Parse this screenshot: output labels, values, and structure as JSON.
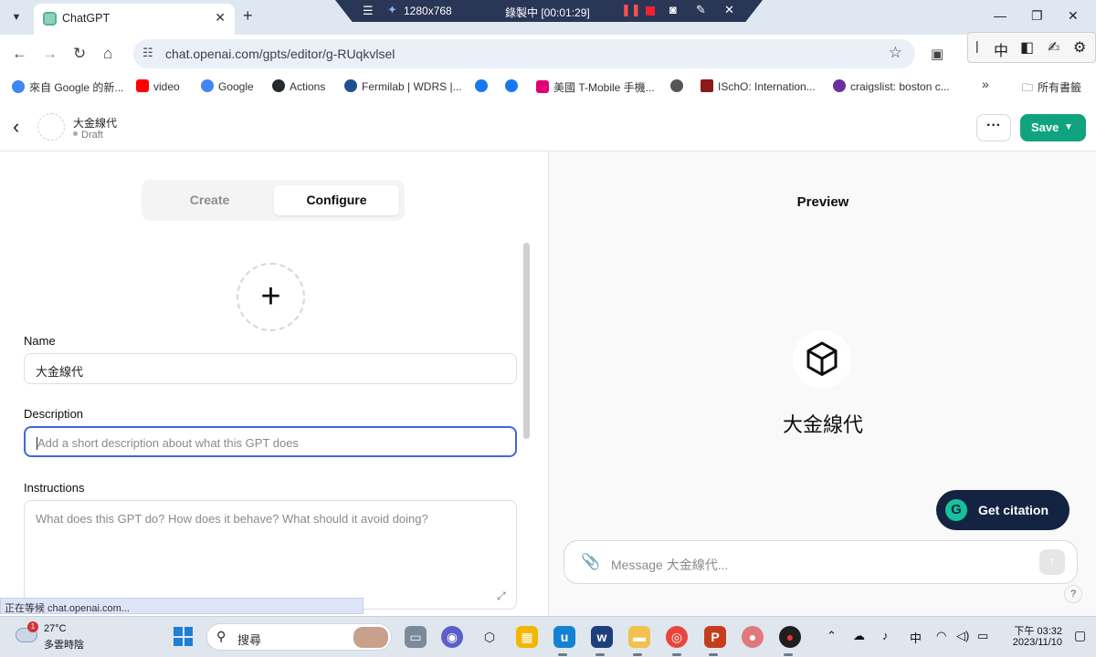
{
  "browser": {
    "tab_title": "ChatGPT",
    "tab_close": "✕",
    "new_tab": "+",
    "url": "chat.openai.com/gpts/editor/g-RUqkvlsel",
    "status_tip": "正在等候 chat.openai.com...",
    "bookmarks": [
      {
        "label": "來自 Google 的新...",
        "icon_color": "#4285f4"
      },
      {
        "label": "video",
        "icon_color": "#ff0000"
      },
      {
        "label": "Google",
        "icon_color": "#4285f4"
      },
      {
        "label": "Actions",
        "icon_color": "#24292f"
      },
      {
        "label": "Fermilab | WDRS |...",
        "icon_color": "#1f4f8f"
      },
      {
        "label": "",
        "icon_color": "#1877f2"
      },
      {
        "label": "",
        "icon_color": "#1877f2"
      },
      {
        "label": "美國 T-Mobile 手機...",
        "icon_color": "#e20074"
      },
      {
        "label": "",
        "icon_color": "#555555"
      },
      {
        "label": "ISchO: Internation...",
        "icon_color": "#8b1a1a"
      },
      {
        "label": "craigslist: boston c...",
        "icon_color": "#6b2fa0"
      }
    ],
    "bookmarks_more": "»",
    "all_bookmarks": "所有書籤"
  },
  "recorder": {
    "resolution": "1280x768",
    "status": "錄製中 [00:01:29]"
  },
  "ime": {
    "mode": "中"
  },
  "header": {
    "gpt_name": "大金線代",
    "status": "Draft",
    "more_label": "···",
    "save_label": "Save"
  },
  "editor": {
    "tabs": [
      "Create",
      "Configure"
    ],
    "active_tab": "Configure",
    "upload_symbol": "+",
    "name_label": "Name",
    "name_value": "大金線代",
    "description_label": "Description",
    "description_placeholder": "Add a short description about what this GPT does",
    "instructions_label": "Instructions",
    "instructions_placeholder": "What does this GPT do? How does it behave? What should it avoid doing?"
  },
  "preview": {
    "title": "Preview",
    "gpt_name": "大金線代",
    "citation_label": "Get citation",
    "message_placeholder": "Message 大金線代...",
    "help": "?"
  },
  "taskbar": {
    "temperature": "27°C",
    "weather": "多雲時陰",
    "weather_badge": "1",
    "search_label": "搜尋",
    "ime": "中",
    "time": "下午 03:32",
    "date": "2023/11/10"
  },
  "colors": {
    "save_green": "#10a37f",
    "focus_blue": "#3b6bd8",
    "citation_navy": "#152342",
    "grammarly_green": "#15c39a"
  }
}
